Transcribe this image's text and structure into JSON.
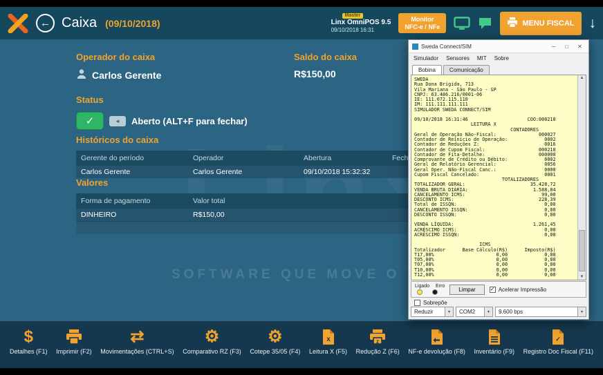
{
  "icons": {
    "back_arrow": "←",
    "down_arrow": "↓",
    "check": "✓",
    "toggle_arrow": "◄",
    "dollar": "$",
    "transfer": "⇄",
    "gear": "⚙",
    "minimize": "─",
    "maximize": "□",
    "close": "✕",
    "dropdown": "▼",
    "scroll_up": "▲",
    "scroll_down": "▼"
  },
  "header": {
    "title": "Caixa",
    "date": "(09/10/2018)",
    "badge": "Master",
    "app_name": "Linx OmniPOS  9.5",
    "datetime": "09/10/2018 16:31",
    "monitor_button_line1": "Monitor",
    "monitor_button_line2": "NFC-e / NFe",
    "menu_fiscal_label": "MENU FISCAL"
  },
  "main": {
    "operador": {
      "label": "Operador do caixa",
      "value": "Carlos Gerente"
    },
    "saldo": {
      "label": "Saldo do caixa",
      "value": "R$150,00"
    },
    "status": {
      "label": "Status",
      "value": "Aberto (ALT+F para fechar)"
    },
    "historicos": {
      "title": "Históricos do caixa",
      "headers": [
        "Gerente do período",
        "Operador",
        "Abertura",
        "Fechamento"
      ],
      "rows": [
        [
          "Carlos Gerente",
          "Carlos Gerente",
          "09/10/2018 15:32:32",
          ""
        ]
      ]
    },
    "valores": {
      "title": "Valores",
      "headers": [
        "Forma de pagamento",
        "Valor total",
        ""
      ],
      "rows": [
        [
          "DINHEIRO",
          "R$150,00",
          ""
        ]
      ]
    },
    "watermark_logo": "Linx",
    "watermark": "SOFTWARE QUE MOVE O VAREJO"
  },
  "toolbar": {
    "items": [
      {
        "label": "Detalhes (F1)"
      },
      {
        "label": "Imprimir (F2)"
      },
      {
        "label": "Movimentações (CTRL+S)"
      },
      {
        "label": "Comparativo RZ (F3)"
      },
      {
        "label": "Cotepe 35/05 (F4)"
      },
      {
        "label": "Leitura X (F5)"
      },
      {
        "label": "Redução Z (F6)"
      },
      {
        "label": "NF-e devolução (F8)"
      },
      {
        "label": "Inventário (F9)"
      },
      {
        "label": "Registro Doc Fiscal (F11)"
      }
    ]
  },
  "sweda": {
    "window_title": "Sweda Connect/SIM",
    "menu": [
      "Simulador",
      "Sensores",
      "MIT",
      "Sobre"
    ],
    "tabs": [
      "Bobina",
      "Comunicação"
    ],
    "receipt_lines": [
      "SWEDA",
      "Rua Dona Brígida, 713",
      "Vila Mariana - São Paulo - SP",
      "CNPJ: 63.486.216/0001-06",
      "IE: 111.072.115.110",
      "IM: 111.111.111.111",
      "SIMULADOR SWEDA CONNECT/SIM",
      "",
      "09/10/2018 16:31:46                     COO:000210",
      "                    LEITURA X",
      "                                  CONTADORES",
      "Geral de Operação Não-Fiscal:               000027",
      "Contador de Reinício de Operação:             0002",
      "Contador de Reduções Z:                       0016",
      "Contador de Cupom Fiscal:                   000210",
      "Contador de Fita-Detalhe:                   000000",
      "Comprovante de Crédito ou Débito:             0002",
      "Geral de Relatório Gerencial:                 0056",
      "Geral Oper. Não-Fiscal Canc.:                 0000",
      "Cupom Fiscal Cancelado:                       0001",
      "                               TOTALIZADORES",
      "TOTALIZADOR GERAL:                       35.428,72",
      "VENDA BRUTA DIÁRIA:                       1.588,84",
      "CANCELAMENTO ICMS:                           99,00",
      "DESCONTO ICMS:                              228,39",
      "Total de ISSQN:                               0,00",
      "CANCELAMENTO ISSQN:                           0,00",
      "DESCONTO ISSQN:                               0,00",
      "",
      "VENDA LÍQUIDA:                            1.261,45",
      "ACRÉSCIMO ICMS:                               0,00",
      "ACRÉSCIMO ISSQN:                              0,00",
      "",
      "                       ICMS",
      "Totalizador      Base Cálculo(R$)      Imposto(R$)",
      "T17,00%                      0,00             0,00",
      "T05,00%                      0,00             0,00",
      "T07,00%                      0,00             0,00",
      "T10,00%                      0,00             0,00",
      "T12,00%                      0,00             0,00"
    ],
    "controls": {
      "ligado": "Ligado",
      "erro": "Erro",
      "limpar": "Limpar",
      "acelerar": "Acelerar Impressão",
      "sobrepoe": "Sobrepõe",
      "reduzir": "Reduzir",
      "port": "COM2",
      "baud": "9.600 bps"
    }
  }
}
